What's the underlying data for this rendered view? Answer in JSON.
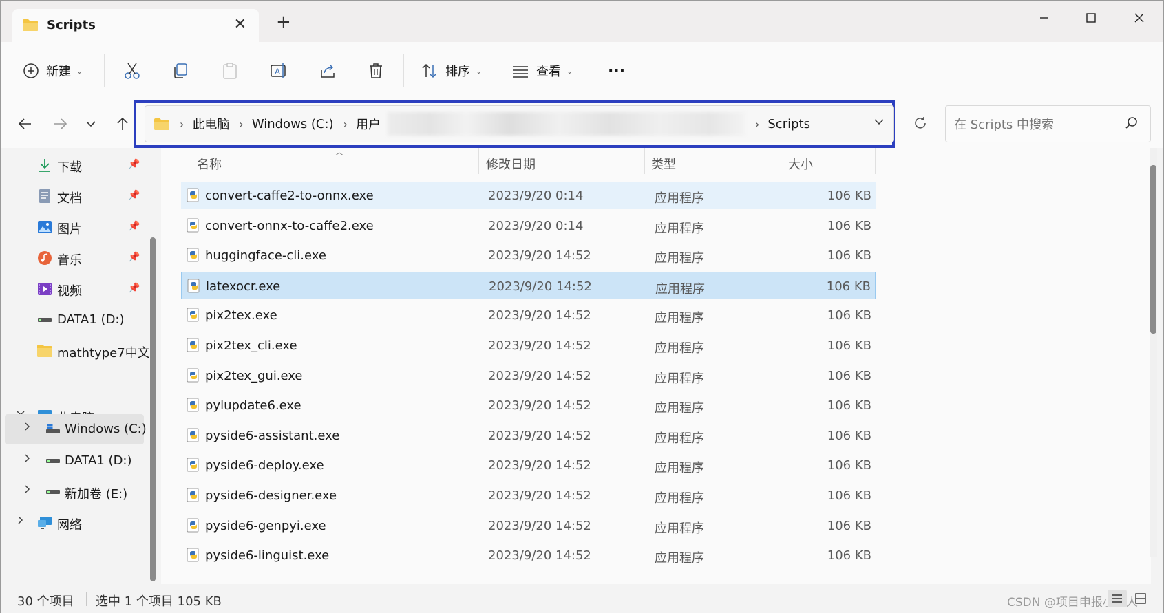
{
  "tab": {
    "title": "Scripts"
  },
  "toolbar": {
    "new_label": "新建",
    "sort_label": "排序",
    "view_label": "查看",
    "more_label": "···"
  },
  "address": {
    "crumbs": [
      "此电脑",
      "Windows (C:)",
      "用户"
    ],
    "last_crumb": "Scripts"
  },
  "search": {
    "placeholder": "在 Scripts 中搜索"
  },
  "sidebar": {
    "quick": [
      {
        "label": "下载",
        "icon": "download-icon",
        "pinned": true
      },
      {
        "label": "文档",
        "icon": "documents-icon",
        "pinned": true
      },
      {
        "label": "图片",
        "icon": "pictures-icon",
        "pinned": true
      },
      {
        "label": "音乐",
        "icon": "music-icon",
        "pinned": true
      },
      {
        "label": "视频",
        "icon": "videos-icon",
        "pinned": true
      },
      {
        "label": "DATA1 (D:)",
        "icon": "drive-icon",
        "pinned": false
      },
      {
        "label": "mathtype7中文",
        "icon": "folder-icon",
        "pinned": false
      }
    ],
    "this_pc": "此电脑",
    "drives": [
      "Windows (C:)",
      "DATA1 (D:)",
      "新加卷 (E:)"
    ],
    "network": "网络"
  },
  "columns": {
    "name": "名称",
    "date": "修改日期",
    "type": "类型",
    "size": "大小"
  },
  "files": [
    {
      "name": "convert-caffe2-to-onnx.exe",
      "date": "2023/9/20 0:14",
      "type": "应用程序",
      "size": "106 KB"
    },
    {
      "name": "convert-onnx-to-caffe2.exe",
      "date": "2023/9/20 0:14",
      "type": "应用程序",
      "size": "106 KB"
    },
    {
      "name": "huggingface-cli.exe",
      "date": "2023/9/20 14:52",
      "type": "应用程序",
      "size": "106 KB"
    },
    {
      "name": "latexocr.exe",
      "date": "2023/9/20 14:52",
      "type": "应用程序",
      "size": "106 KB"
    },
    {
      "name": "pix2tex.exe",
      "date": "2023/9/20 14:52",
      "type": "应用程序",
      "size": "106 KB"
    },
    {
      "name": "pix2tex_cli.exe",
      "date": "2023/9/20 14:52",
      "type": "应用程序",
      "size": "106 KB"
    },
    {
      "name": "pix2tex_gui.exe",
      "date": "2023/9/20 14:52",
      "type": "应用程序",
      "size": "106 KB"
    },
    {
      "name": "pylupdate6.exe",
      "date": "2023/9/20 14:52",
      "type": "应用程序",
      "size": "106 KB"
    },
    {
      "name": "pyside6-assistant.exe",
      "date": "2023/9/20 14:52",
      "type": "应用程序",
      "size": "106 KB"
    },
    {
      "name": "pyside6-deploy.exe",
      "date": "2023/9/20 14:52",
      "type": "应用程序",
      "size": "106 KB"
    },
    {
      "name": "pyside6-designer.exe",
      "date": "2023/9/20 14:52",
      "type": "应用程序",
      "size": "106 KB"
    },
    {
      "name": "pyside6-genpyi.exe",
      "date": "2023/9/20 14:52",
      "type": "应用程序",
      "size": "106 KB"
    },
    {
      "name": "pyside6-linguist.exe",
      "date": "2023/9/20 14:52",
      "type": "应用程序",
      "size": "106 KB"
    }
  ],
  "selection": {
    "hovered_index": 0,
    "selected_index": 3
  },
  "status": {
    "count": "30 个项目",
    "selected": "选中 1 个项目  105 KB",
    "watermark": "CSDN @项目申报小狂人"
  },
  "colors": {
    "accent": "#2c3fbf",
    "selected_row": "#cce4f7",
    "hover_row": "#e5f1fb",
    "folder": "#f4c542"
  }
}
